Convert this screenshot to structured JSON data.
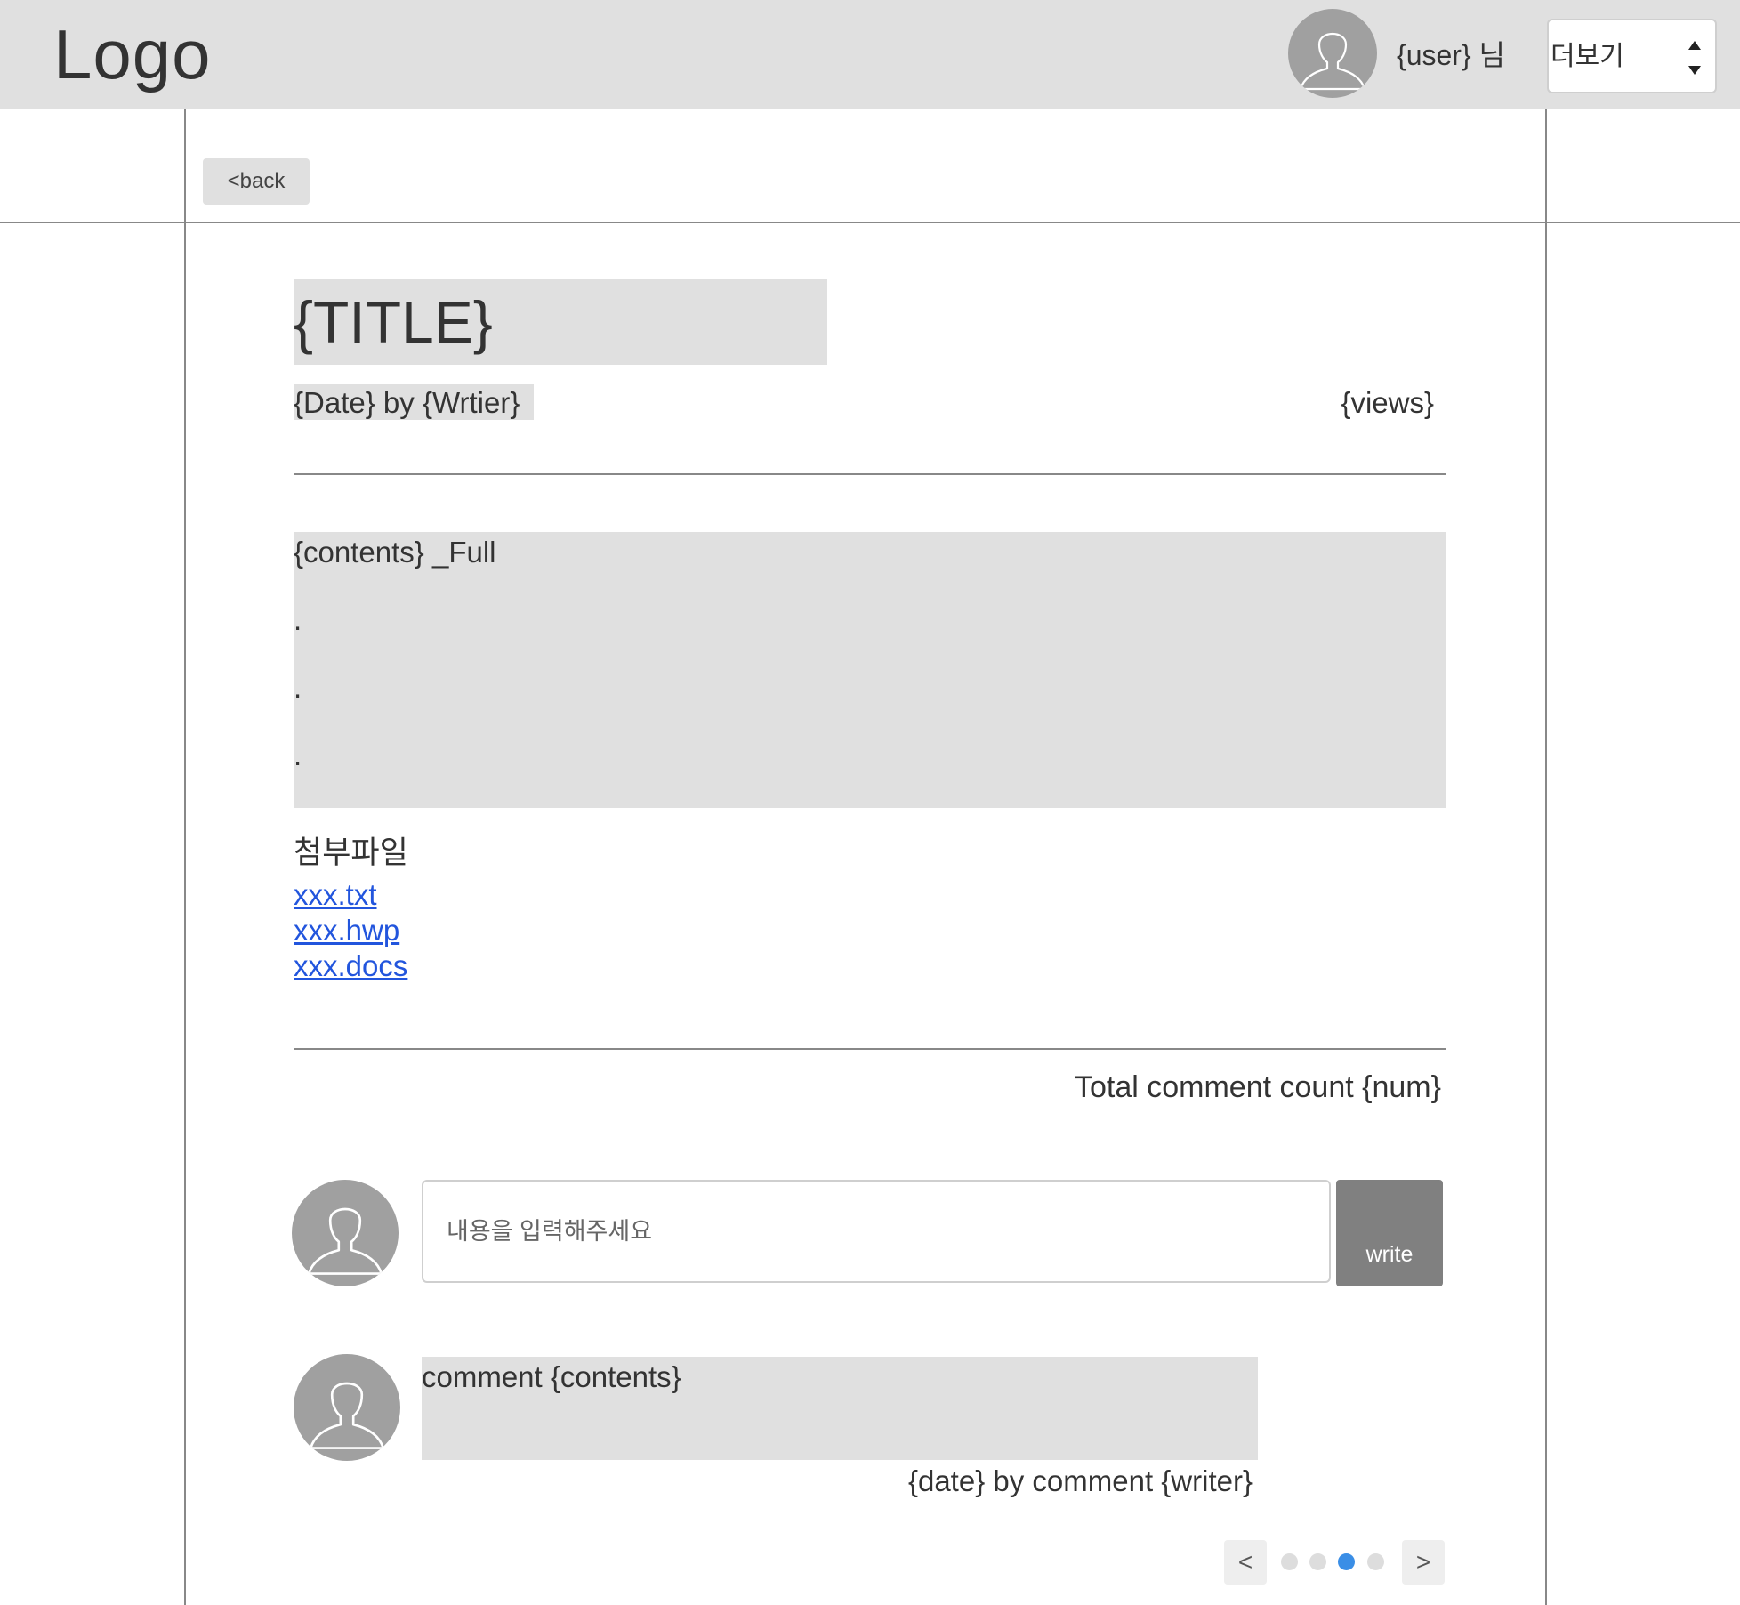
{
  "header": {
    "logo": "Logo",
    "user_label": "{user} 님",
    "more_select": {
      "selected": "더보기"
    }
  },
  "nav": {
    "back_label": "<back"
  },
  "post": {
    "title": "{TITLE}",
    "meta": "{Date} by {Wrtier}",
    "views": "{views}",
    "contents": {
      "heading": "{contents} _Full",
      "lines": [
        ".",
        ".",
        "."
      ]
    }
  },
  "attachments": {
    "title": "첨부파일",
    "files": [
      "xxx.txt",
      "xxx.hwp",
      "xxx.docs"
    ]
  },
  "comments": {
    "total_label": "Total comment count {num}",
    "input_placeholder": "내용을 입력해주세요",
    "write_label": "write",
    "items": [
      {
        "contents": "comment {contents}",
        "meta": "{date} by comment {writer}"
      }
    ]
  },
  "pagination": {
    "prev_label": "<",
    "next_label": ">",
    "page_count": 4,
    "active_page": 3
  },
  "colors": {
    "header_bg": "#e0e0e0",
    "placeholder_block": "#e0e0e0",
    "avatar": "#a0a0a0",
    "write_button": "#808080",
    "link": "#2255dd",
    "active_dot": "#3a8ee6"
  },
  "icons": {
    "avatar": "user-silhouette-icon",
    "select": "up-down-arrows-icon"
  }
}
